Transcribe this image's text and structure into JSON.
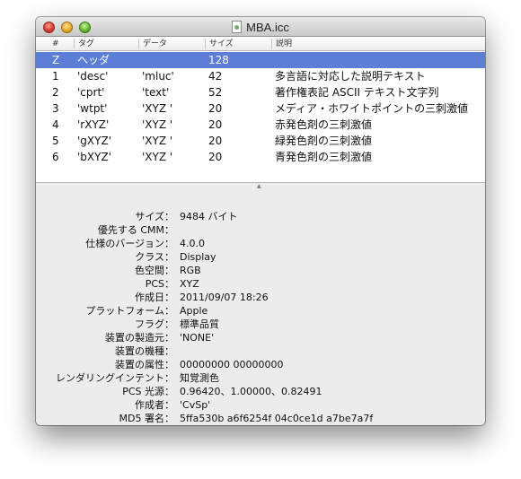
{
  "window": {
    "title": "MBA.icc"
  },
  "table": {
    "columns": [
      "#",
      "タグ",
      "データ",
      "サイズ",
      "説明"
    ],
    "rows": [
      {
        "num": "Z",
        "tag": "ヘッダ",
        "data": "",
        "size": "128",
        "desc": ""
      },
      {
        "num": "1",
        "tag": "'desc'",
        "data": "'mluc'",
        "size": "42",
        "desc": "多言語に対応した説明テキスト"
      },
      {
        "num": "2",
        "tag": "'cprt'",
        "data": "'text'",
        "size": "52",
        "desc": "著作権表記 ASCII テキスト文字列"
      },
      {
        "num": "3",
        "tag": "'wtpt'",
        "data": "'XYZ '",
        "size": "20",
        "desc": "メディア・ホワイトポイントの三刺激値"
      },
      {
        "num": "4",
        "tag": "'rXYZ'",
        "data": "'XYZ '",
        "size": "20",
        "desc": "赤発色剤の三刺激値"
      },
      {
        "num": "5",
        "tag": "'gXYZ'",
        "data": "'XYZ '",
        "size": "20",
        "desc": "緑発色剤の三刺激値"
      },
      {
        "num": "6",
        "tag": "'bXYZ'",
        "data": "'XYZ '",
        "size": "20",
        "desc": "青発色剤の三刺激値"
      }
    ]
  },
  "details": [
    {
      "label": "サイズ：",
      "value": "9484 バイト"
    },
    {
      "label": "優先する CMM：",
      "value": ""
    },
    {
      "label": "仕様のバージョン：",
      "value": "4.0.0"
    },
    {
      "label": "クラス：",
      "value": "Display"
    },
    {
      "label": "色空間：",
      "value": "RGB"
    },
    {
      "label": "PCS：",
      "value": "XYZ"
    },
    {
      "label": "作成日：",
      "value": "2011/09/07 18:26"
    },
    {
      "label": "プラットフォーム：",
      "value": "Apple"
    },
    {
      "label": "フラグ：",
      "value": "標準品質"
    },
    {
      "label": "装置の製造元：",
      "value": "'NONE'"
    },
    {
      "label": "装置の機種：",
      "value": ""
    },
    {
      "label": "装置の属性：",
      "value": "00000000 00000000"
    },
    {
      "label": "レンダリングインテント：",
      "value": "知覚測色"
    },
    {
      "label": "PCS 光源：",
      "value": "0.96420、1.00000、0.82491"
    },
    {
      "label": "作成者：",
      "value": "'CvSp'"
    },
    {
      "label": "MD5 署名：",
      "value": "5ffa530b a6f6254f 04c0ce1d a7be7a7f"
    }
  ],
  "colors": {
    "selection": "#5d7ed6",
    "window_bg": "#ececec"
  },
  "icons": {
    "title": "icc-document-icon"
  }
}
